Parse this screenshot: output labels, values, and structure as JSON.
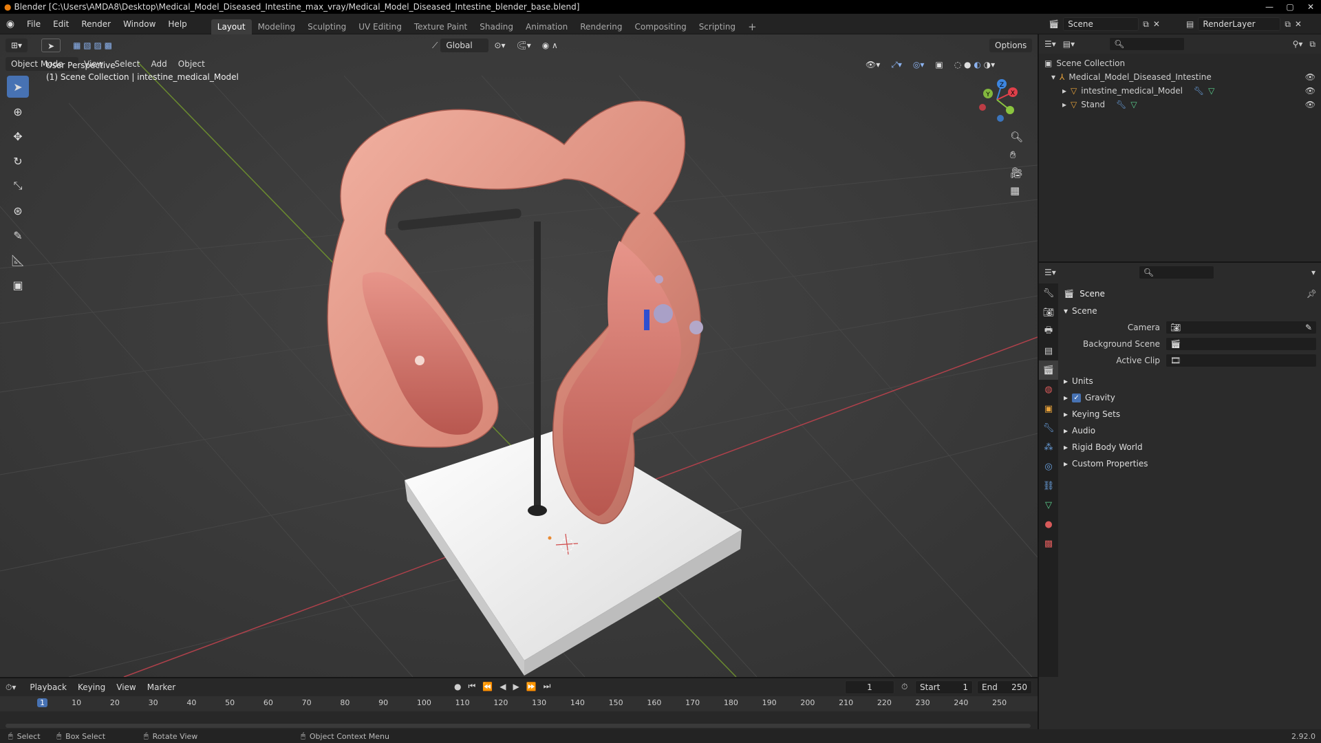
{
  "title": "Blender [C:\\Users\\AMDA8\\Desktop\\Medical_Model_Diseased_Intestine_max_vray/Medical_Model_Diseased_Intestine_blender_base.blend]",
  "menus": [
    "File",
    "Edit",
    "Render",
    "Window",
    "Help"
  ],
  "workspaces": [
    "Layout",
    "Modeling",
    "Sculpting",
    "UV Editing",
    "Texture Paint",
    "Shading",
    "Animation",
    "Rendering",
    "Compositing",
    "Scripting"
  ],
  "scene": "Scene",
  "render_layer": "RenderLayer",
  "viewport": {
    "transform_orientation": "Global",
    "options": "Options",
    "mode": "Object Mode",
    "menus": [
      "View",
      "Select",
      "Add",
      "Object"
    ],
    "perspective": "User Perspective",
    "collection_info": "(1) Scene Collection | intestine_medical_Model",
    "gizmo_axes": [
      "Z",
      "Y",
      "X"
    ]
  },
  "outliner": {
    "root": "Scene Collection",
    "items": [
      {
        "label": "Medical_Model_Diseased_Intestine"
      },
      {
        "label": "intestine_medical_Model"
      },
      {
        "label": "Stand"
      }
    ]
  },
  "properties": {
    "context": "Scene",
    "panel": "Scene",
    "fields": [
      {
        "label": "Camera"
      },
      {
        "label": "Background Scene"
      },
      {
        "label": "Active Clip"
      }
    ],
    "sections": [
      "Units",
      "Gravity",
      "Keying Sets",
      "Audio",
      "Rigid Body World",
      "Custom Properties"
    ],
    "gravity_checked": true
  },
  "timeline": {
    "menus": [
      "Playback",
      "Keying",
      "View",
      "Marker"
    ],
    "current_frame": "1",
    "start_label": "Start",
    "start": "1",
    "end_label": "End",
    "end": "250",
    "ruler": [
      "1",
      "10",
      "20",
      "30",
      "40",
      "50",
      "60",
      "70",
      "80",
      "90",
      "100",
      "110",
      "120",
      "130",
      "140",
      "150",
      "160",
      "170",
      "180",
      "190",
      "200",
      "210",
      "220",
      "230",
      "240",
      "250"
    ]
  },
  "status": {
    "items": [
      "Select",
      "Box Select",
      "Rotate View",
      "Object Context Menu"
    ],
    "version": "2.92.0"
  },
  "colors": {
    "accent": "#4772b3",
    "x_axis": "#e0404a",
    "y_axis": "#8bc53f",
    "z_axis": "#3d86e0",
    "viewport_bg": "#3a3a3a"
  }
}
